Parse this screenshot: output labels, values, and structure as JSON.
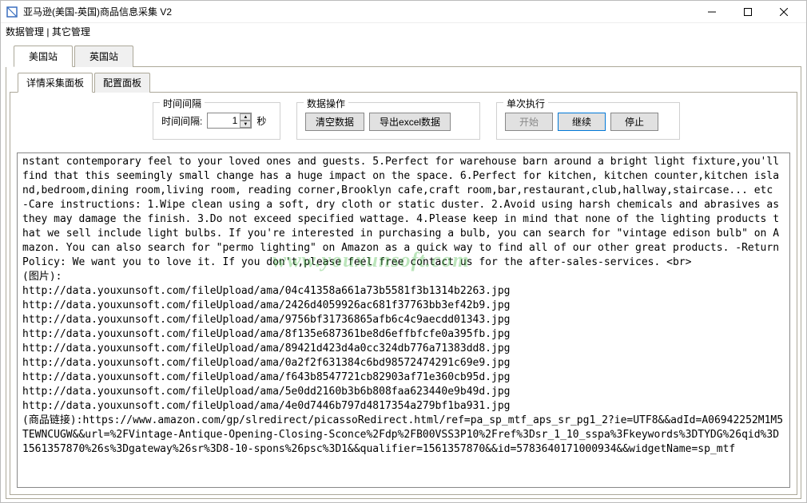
{
  "window": {
    "title": "亚马逊(美国-英国)商品信息采集 V2",
    "icon_name": "app-icon"
  },
  "menubar": {
    "data_mgmt": "数据管理",
    "sep": " | ",
    "other_mgmt": "其它管理"
  },
  "tabs": {
    "us": "美国站",
    "uk": "英国站"
  },
  "subtabs": {
    "detail": "详情采集面板",
    "config": "配置面板"
  },
  "groups": {
    "interval": {
      "title": "时间间隔",
      "label": "时间间隔:",
      "value": "1",
      "unit": "秒"
    },
    "dataop": {
      "title": "数据操作",
      "clear": "清空数据",
      "export": "导出excel数据"
    },
    "single": {
      "title": "单次执行",
      "start": "开始",
      "continue": "继续",
      "stop": "停止"
    }
  },
  "log_text": "nstant contemporary feel to your loved ones and guests. 5.Perfect for warehouse barn around a bright light fixture,you'll find that this seemingly small change has a huge impact on the space. 6.Perfect for kitchen, kitchen counter,kitchen island,bedroom,dining room,living room, reading corner,Brooklyn cafe,craft room,bar,restaurant,club,hallway,staircase... etc -Care instructions: 1.Wipe clean using a soft, dry cloth or static duster. 2.Avoid using harsh chemicals and abrasives as they may damage the finish. 3.Do not exceed specified wattage. 4.Please keep in mind that none of the lighting products that we sell include light bulbs. If you're interested in purchasing a bulb, you can search for \"vintage edison bulb\" on Amazon. You can also search for \"permo lighting\" on Amazon as a quick way to find all of our other great products. -Return Policy: We want you to love it. If you don't,please feel free contact us for the after-sales-services. <br>\n(图片):\nhttp://data.youxunsoft.com/fileUpload/ama/04c41358a661a73b5581f3b1314b2263.jpg\nhttp://data.youxunsoft.com/fileUpload/ama/2426d4059926ac681f37763bb3ef42b9.jpg\nhttp://data.youxunsoft.com/fileUpload/ama/9756bf31736865afb6c4c9aecdd01343.jpg\nhttp://data.youxunsoft.com/fileUpload/ama/8f135e687361be8d6effbfcfe0a395fb.jpg\nhttp://data.youxunsoft.com/fileUpload/ama/89421d423d4a0cc324db776a71383dd8.jpg\nhttp://data.youxunsoft.com/fileUpload/ama/0a2f2f631384c6bd98572474291c69e9.jpg\nhttp://data.youxunsoft.com/fileUpload/ama/f643b8547721cb82903af71e360cb95d.jpg\nhttp://data.youxunsoft.com/fileUpload/ama/5e0dd2160b3b6b808faa623440e9b49d.jpg\nhttp://data.youxunsoft.com/fileUpload/ama/4e0d7446b797d4817354a279bf1ba931.jpg\n(商品链接):https://www.amazon.com/gp/slredirect/picassoRedirect.html/ref=pa_sp_mtf_aps_sr_pg1_2?ie=UTF8&&adId=A06942252M1M5TEWNCUGW&&url=%2FVintage-Antique-Opening-Closing-Sconce%2Fdp%2FB00VSS3P10%2Fref%3Dsr_1_10_sspa%3Fkeywords%3DTYDG%26qid%3D1561357870%26s%3Dgateway%26sr%3D8-10-spons%26psc%3D1&&qualifier=1561357870&&id=5783640171000934&&widgetName=sp_mtf",
  "watermark": "www.youxunsoft.com"
}
